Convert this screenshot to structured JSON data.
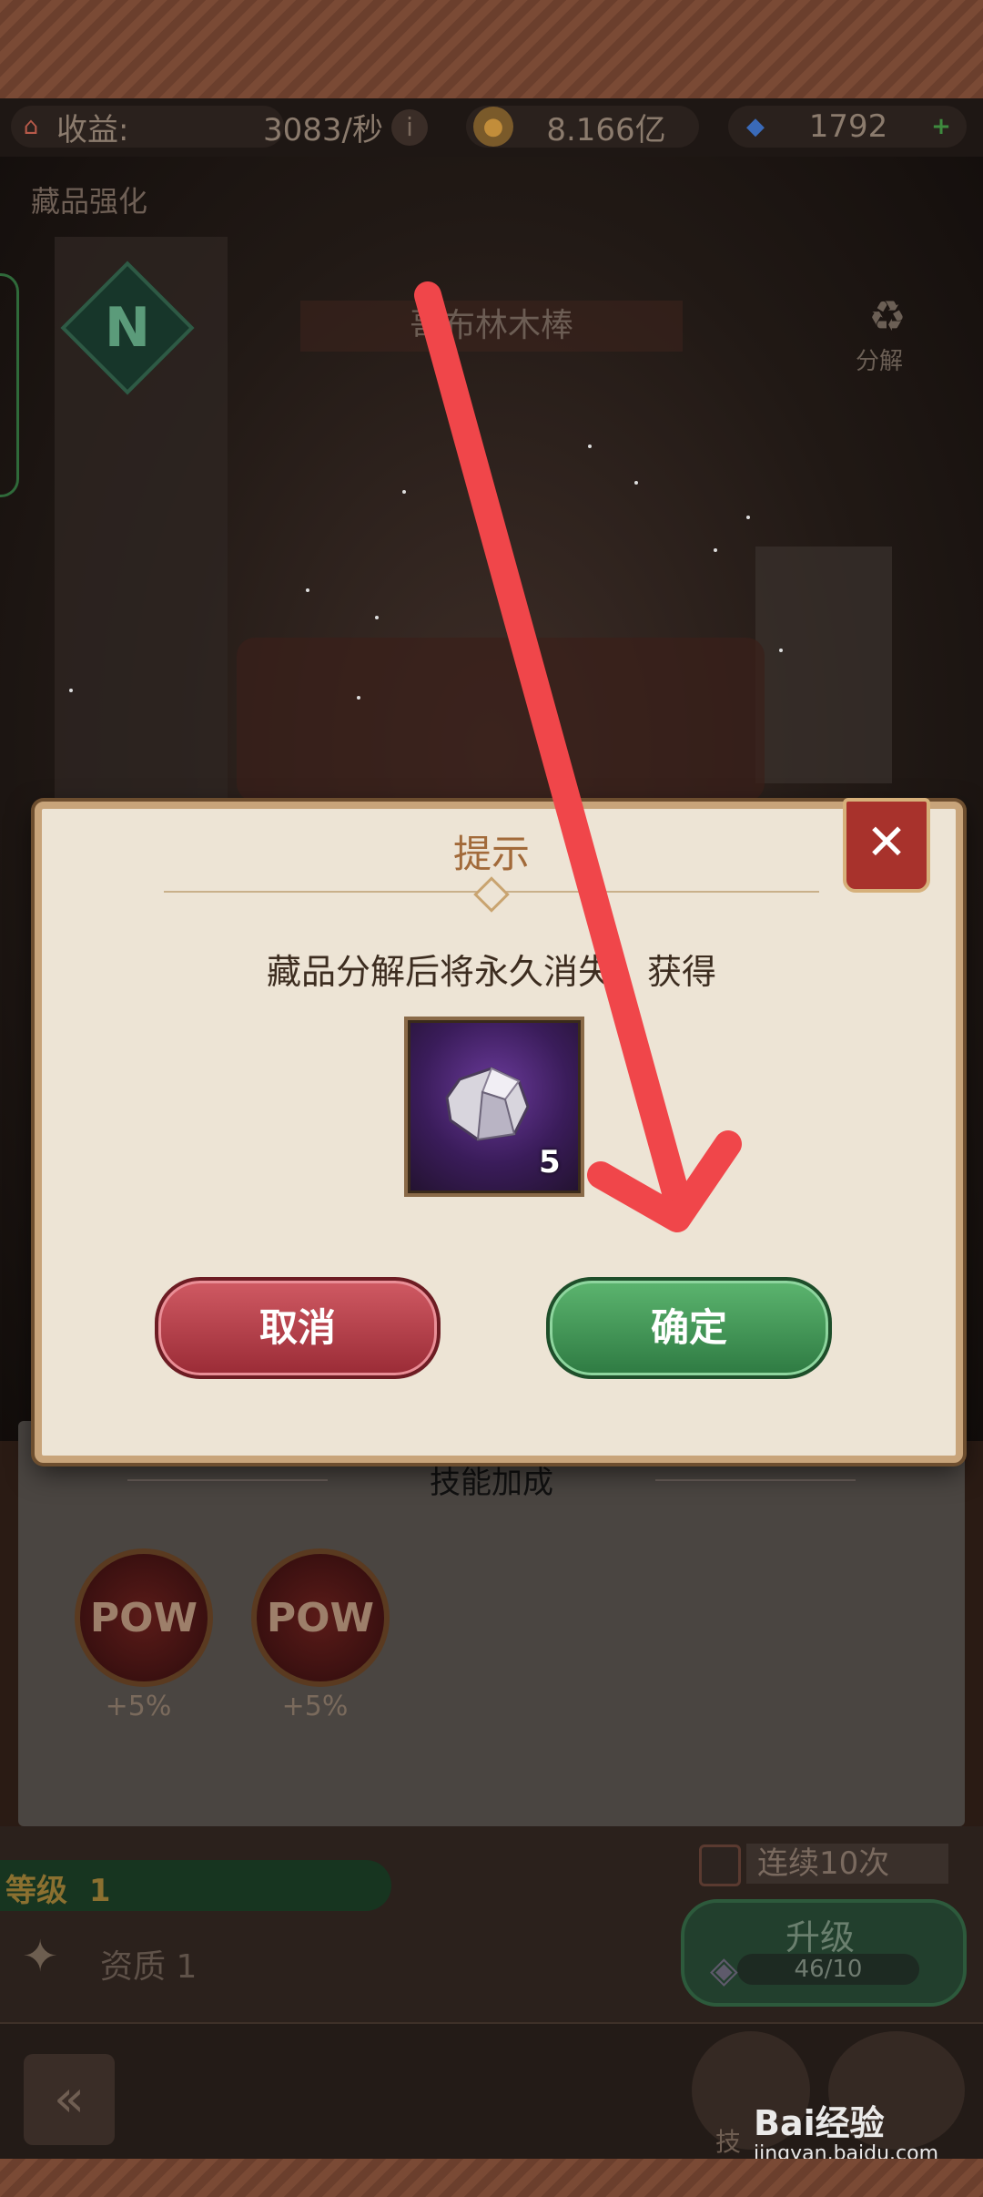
{
  "resources": {
    "income_label": "收益:",
    "income_value": "3083/秒",
    "coins_value": "8.166亿",
    "gems_value": "1792"
  },
  "page": {
    "title": "藏品强化",
    "item_name": "哥布林木棒",
    "decompose_label": "分解",
    "rarity_badge": "N"
  },
  "dialog": {
    "title": "提示",
    "message": "藏品分解后将永久消失，获得",
    "reward_count": "5",
    "cancel_label": "取消",
    "confirm_label": "确定",
    "close_symbol": "✕"
  },
  "skills": {
    "title": "技能加成",
    "items": [
      {
        "icon_text": "POW",
        "bonus": "+5%"
      },
      {
        "icon_text": "POW",
        "bonus": "+5%"
      }
    ]
  },
  "controls": {
    "consecutive_label": "连续10次",
    "level_label": "等级",
    "level_value": "1",
    "quality_label": "资质 1",
    "upgrade_label": "升级",
    "upgrade_progress": "46/10",
    "skill_short": "技"
  },
  "watermark": {
    "brand": "Bai经验",
    "url": "jingyan.baidu.com"
  },
  "colors": {
    "confirm_green": "#2e7a42",
    "cancel_red": "#9a2b36",
    "arrow_red": "#f0464a"
  }
}
